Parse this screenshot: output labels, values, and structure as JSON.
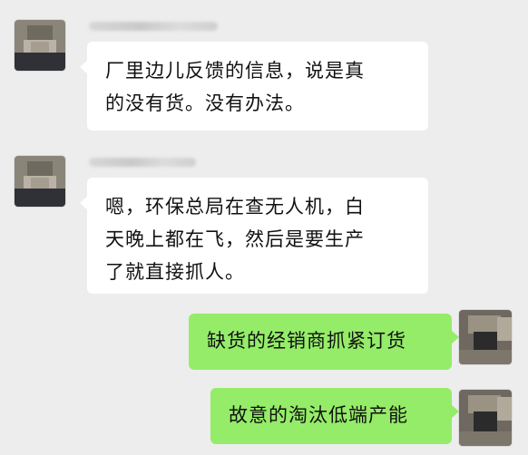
{
  "messages": [
    {
      "direction": "incoming",
      "lines": [
        "厂里边儿反馈的信息，说是真",
        "的没有货。没有办法。"
      ]
    },
    {
      "direction": "incoming",
      "lines": [
        "嗯，环保总局在查无人机，白",
        "天晚上都在飞，然后是要生产",
        "了就直接抓人。"
      ]
    },
    {
      "direction": "outgoing",
      "lines": [
        "缺货的经销商抓紧订货"
      ]
    },
    {
      "direction": "outgoing",
      "lines": [
        "故意的淘汰低端产能"
      ]
    }
  ],
  "colors": {
    "background": "#ededed",
    "incoming_bubble": "#ffffff",
    "outgoing_bubble": "#95ec69"
  }
}
